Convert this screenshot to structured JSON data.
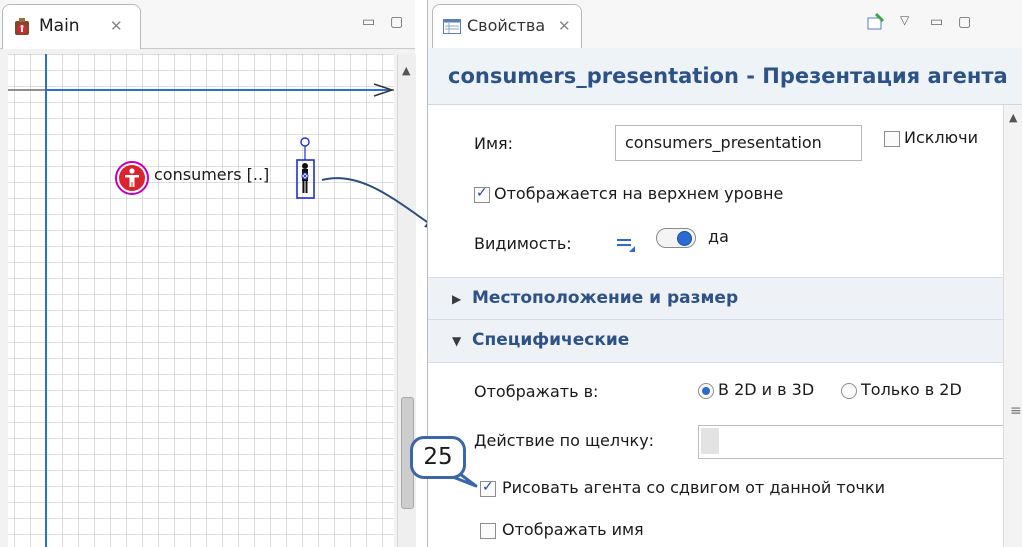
{
  "main_view": {
    "tab_label": "Main",
    "close_glyph": "✕",
    "minimize_glyph": "▭",
    "maximize_glyph": "▢",
    "agent_label": "consumers [..]"
  },
  "properties_view": {
    "tab_label": "Свойства",
    "close_glyph": "✕",
    "title": "consumers_presentation - Презентация агента",
    "name_label": "Имя:",
    "name_value": "consumers_presentation",
    "exclude_label": "Исключи",
    "top_level_label": "Отображается на верхнем уровне",
    "visibility_label": "Видимость:",
    "visibility_value": "да",
    "section_location": "Местоположение и размер",
    "section_specific": "Специфические",
    "show_in_label": "Отображать в:",
    "option_2d3d": "В 2D и в 3D",
    "option_2d": "Только в 2D",
    "click_action_label": "Действие по щелчку:",
    "draw_offset_label": "Рисовать агента со сдвигом от данной точки",
    "show_name_label": "Отображать имя",
    "show_in_selected": "В 2D и в 3D",
    "top_level_checked": true,
    "draw_offset_checked": true,
    "show_name_checked": false,
    "exclude_checked": false,
    "visibility_on": true
  },
  "callout_number": "25",
  "colors": {
    "title_blue": "#2d5287",
    "accent_blue": "#2b6ad1",
    "axis_blue": "#2d6fd0",
    "arrow_blue": "#2a4f7c",
    "agent_red": "#d9232e"
  },
  "icons": [
    "main-tab-icon",
    "properties-tab-icon",
    "pin-icon",
    "menu-icon",
    "agent-icon",
    "agent-figure-icon",
    "dynamic-value-icon",
    "toggle-switch-icon"
  ]
}
